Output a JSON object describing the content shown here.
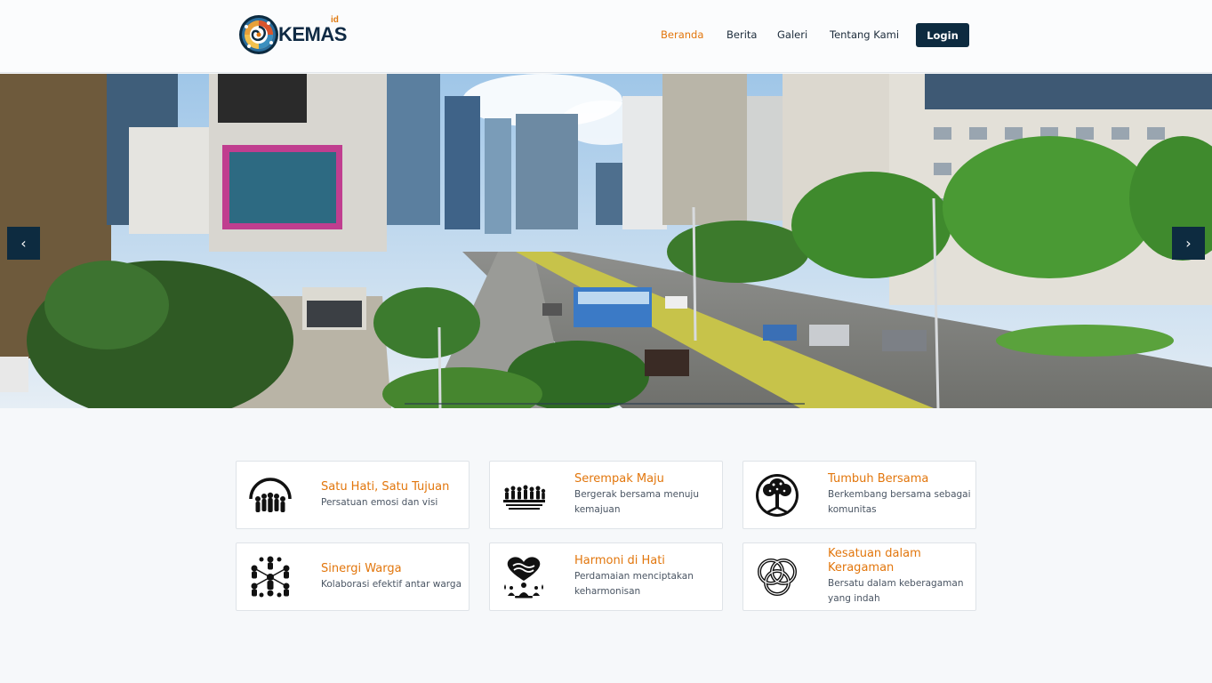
{
  "brand": {
    "name": "KEMAS",
    "suffix": "id",
    "accent_color": "#e2760c",
    "primary_color": "#0d2b40"
  },
  "nav": {
    "items": [
      {
        "label": "Beranda",
        "active": true
      },
      {
        "label": "Berita",
        "active": false
      },
      {
        "label": "Galeri",
        "active": false
      },
      {
        "label": "Tentang Kami",
        "active": false
      }
    ],
    "login_label": "Login"
  },
  "hero": {
    "prev_icon": "chevron-left-icon",
    "next_icon": "chevron-right-icon",
    "prev_glyph": "‹",
    "next_glyph": "›"
  },
  "features": [
    {
      "title": "Satu Hati, Satu Tujuan",
      "description": "Persatuan emosi dan visi",
      "icon": "unity-circle-icon"
    },
    {
      "title": "Serempak Maju",
      "description": "Bergerak bersama menuju kemajuan",
      "icon": "crowd-forward-icon"
    },
    {
      "title": "Tumbuh Bersama",
      "description": "Berkembang bersama sebagai komunitas",
      "icon": "tree-icon"
    },
    {
      "title": "Sinergi Warga",
      "description": "Kolaborasi efektif antar warga",
      "icon": "people-network-icon"
    },
    {
      "title": "Harmoni di Hati",
      "description": "Perdamaian menciptakan keharmonisan",
      "icon": "heart-meditation-icon"
    },
    {
      "title": "Kesatuan dalam Keragaman",
      "description": "Bersatu dalam keberagaman yang indah",
      "icon": "celtic-knot-icon"
    }
  ]
}
